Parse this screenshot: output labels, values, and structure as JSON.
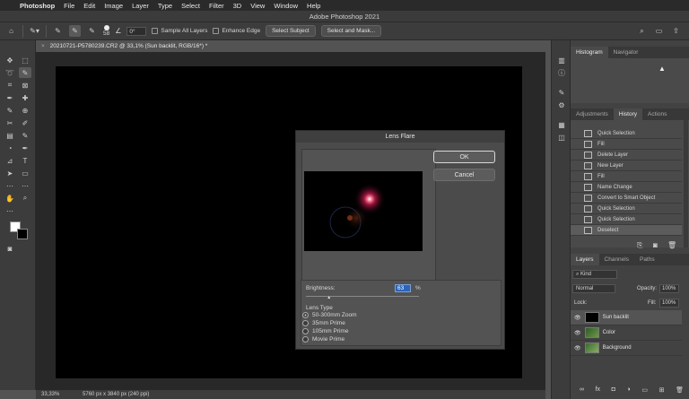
{
  "menubar": {
    "apple": "",
    "app": "Photoshop",
    "items": [
      "File",
      "Edit",
      "Image",
      "Layer",
      "Type",
      "Select",
      "Filter",
      "3D",
      "View",
      "Window",
      "Help"
    ]
  },
  "window_title": "Adobe Photoshop 2021",
  "options": {
    "brush_size": "58",
    "angle": "0°",
    "sample_all_layers": "Sample All Layers",
    "enhance_edge": "Enhance Edge",
    "select_subject": "Select Subject",
    "select_and_mask": "Select and Mask..."
  },
  "document": {
    "tab_title": "20210721-P5780239.CR2 @ 33,1% (Sun backlit, RGB/16*) *",
    "close": "×"
  },
  "status": {
    "zoom": "33,33%",
    "info": "5760 px x 3840 px (240 ppi)"
  },
  "dialog": {
    "title": "Lens Flare",
    "ok": "OK",
    "cancel": "Cancel",
    "brightness_label": "Brightness:",
    "brightness_value": "63",
    "percent": "%",
    "lens_type_label": "Lens Type",
    "lens_types": [
      "50-300mm Zoom",
      "35mm Prime",
      "105mm Prime",
      "Movie Prime"
    ],
    "selected_lens_index": 0,
    "brightness_fraction": 0.2
  },
  "panels": {
    "top_tabs": [
      "Histogram",
      "Navigator"
    ],
    "mid_tabs": [
      "Adjustments",
      "History",
      "Actions"
    ],
    "history": [
      "Quick Selection",
      "Fill",
      "Delete Layer",
      "New Layer",
      "Fill",
      "Name Change",
      "Convert to Smart Object",
      "Quick Selection",
      "Quick Selection",
      "Deselect"
    ],
    "layer_tabs": [
      "Layers",
      "Channels",
      "Paths"
    ],
    "kind": "Kind",
    "blend": "Normal",
    "opacity_label": "Opacity:",
    "opacity": "100%",
    "lock_label": "Lock:",
    "fill_label": "Fill:",
    "fill": "100%",
    "layers": [
      "Sun backlit",
      "Color",
      "Background"
    ]
  }
}
